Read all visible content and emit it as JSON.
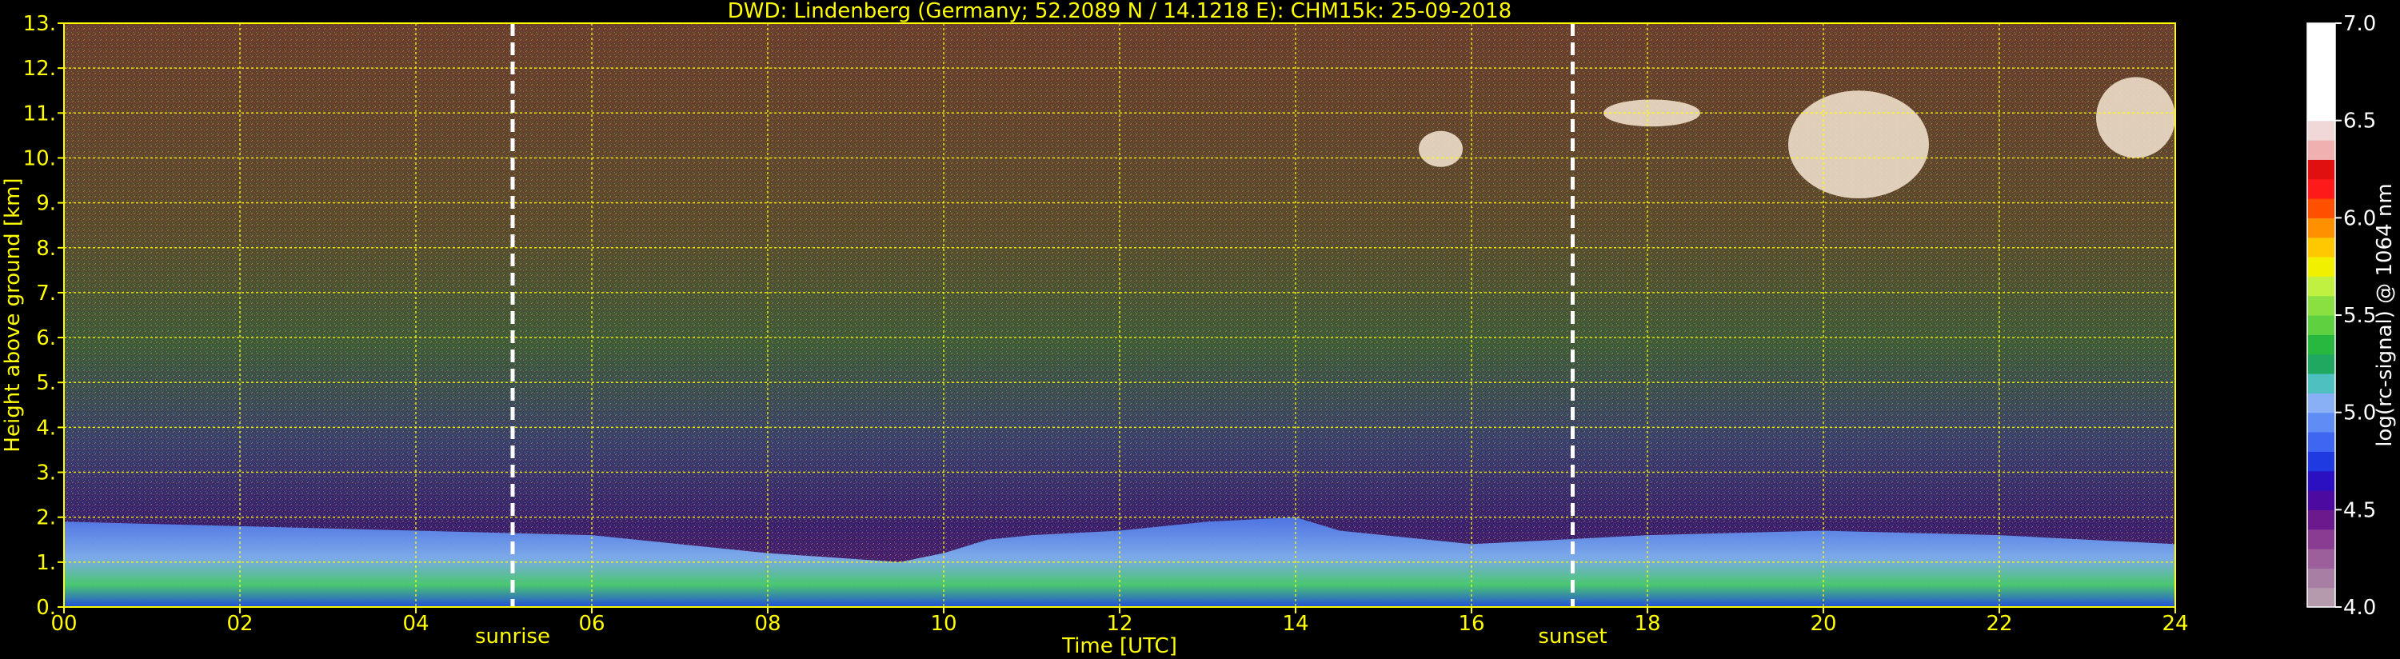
{
  "chart_data": {
    "type": "heatmap",
    "title": "DWD: Lindenberg (Germany; 52.2089 N / 14.1218 E):     CHM15k: 25-09-2018",
    "xlabel": "Time [UTC]",
    "ylabel": "Height above ground [km]",
    "xlim": [
      0,
      24
    ],
    "ylim": [
      0,
      13
    ],
    "x_ticks": [
      "00",
      "02",
      "04",
      "06",
      "08",
      "10",
      "12",
      "14",
      "16",
      "18",
      "20",
      "22",
      "24"
    ],
    "y_ticks": [
      "0.",
      "1.",
      "2.",
      "3.",
      "4.",
      "5.",
      "6.",
      "7.",
      "8.",
      "9.",
      "10.",
      "11.",
      "12.",
      "13."
    ],
    "grid": true,
    "events": [
      {
        "name": "sunrise",
        "time_utc": 5.1
      },
      {
        "name": "sunset",
        "time_utc": 17.15
      }
    ],
    "boundary_layer_top_km": [
      [
        0,
        1.9
      ],
      [
        2,
        1.8
      ],
      [
        4,
        1.7
      ],
      [
        6,
        1.6
      ],
      [
        8,
        1.2
      ],
      [
        9.5,
        1.0
      ],
      [
        10,
        1.2
      ],
      [
        10.5,
        1.5
      ],
      [
        11,
        1.6
      ],
      [
        12,
        1.7
      ],
      [
        13,
        1.9
      ],
      [
        14,
        2.0
      ],
      [
        14.5,
        1.7
      ],
      [
        16,
        1.4
      ],
      [
        18,
        1.6
      ],
      [
        20,
        1.7
      ],
      [
        22,
        1.6
      ],
      [
        24,
        1.4
      ]
    ],
    "clouds": [
      {
        "time_utc": [
          15.4,
          15.9
        ],
        "height_km": [
          9.8,
          10.6
        ]
      },
      {
        "time_utc": [
          17.5,
          18.6
        ],
        "height_km": [
          10.7,
          11.3
        ]
      },
      {
        "time_utc": [
          19.6,
          21.2
        ],
        "height_km": [
          9.1,
          11.5
        ]
      },
      {
        "time_utc": [
          23.1,
          24.0
        ],
        "height_km": [
          10.0,
          11.8
        ]
      }
    ],
    "colorbar": {
      "label": "log(rc-signal) @ 1064 nm",
      "range": [
        4.0,
        7.0
      ],
      "ticks": [
        "4.0",
        "4.5",
        "5.0",
        "5.5",
        "6.0",
        "6.5",
        "7.0"
      ],
      "colors": [
        "#b59aae",
        "#a87ea5",
        "#9c5f9c",
        "#8a3c92",
        "#6a1a8c",
        "#4d0aa0",
        "#2a10c0",
        "#1f3ae0",
        "#3f66f0",
        "#5f8cf5",
        "#89b0f5",
        "#4fc0c0",
        "#20a860",
        "#28b840",
        "#5fd040",
        "#8ae040",
        "#c0f040",
        "#f0f000",
        "#ffc800",
        "#ff9000",
        "#ff5000",
        "#ff1a1a",
        "#e01010",
        "#f0b0b0",
        "#f0d8d8",
        "#ffffff",
        "#ffffff",
        "#ffffff",
        "#ffffff",
        "#ffffff"
      ]
    }
  }
}
